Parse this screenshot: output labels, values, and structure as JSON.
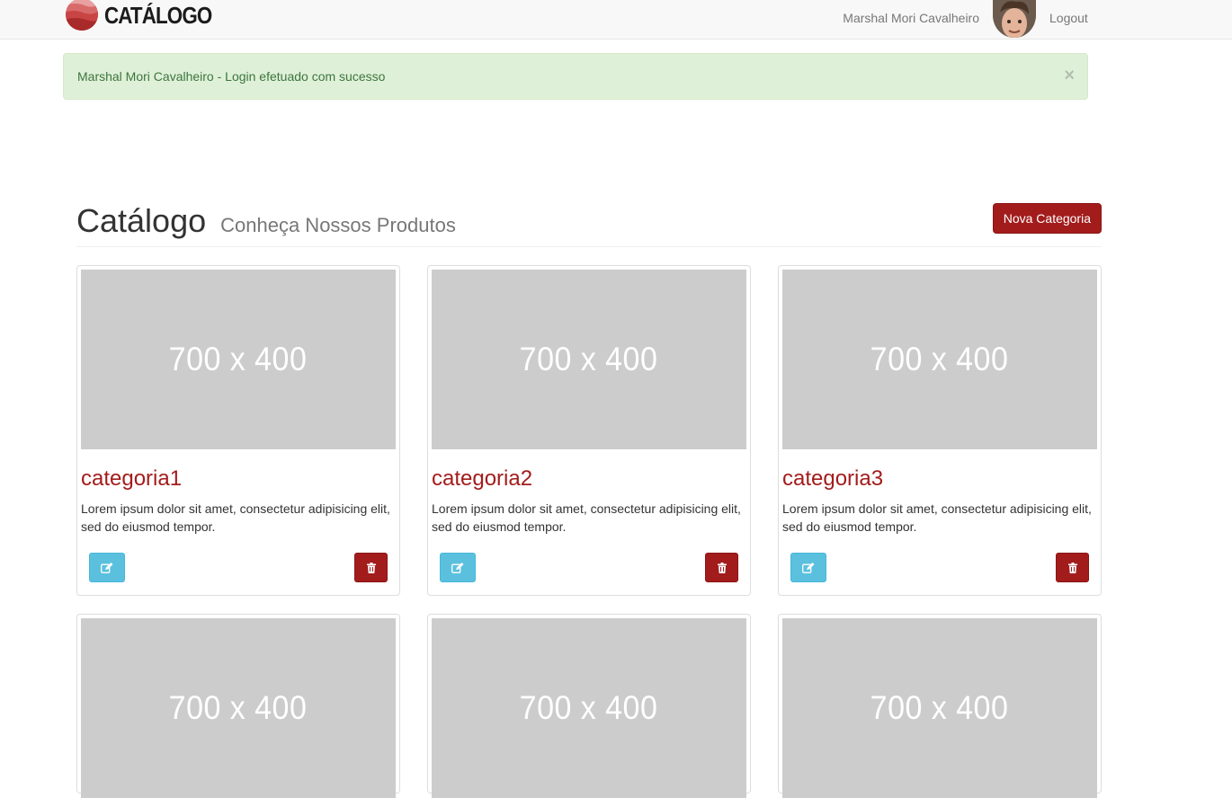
{
  "navbar": {
    "brand_text": "CATÁLOGO",
    "user_name": "Marshal Mori Cavalheiro",
    "logout_label": "Logout"
  },
  "alert": {
    "message": "Marshal Mori Cavalheiro - Login efetuado com sucesso",
    "close_symbol": "×",
    "color": "#dff0d8"
  },
  "page_header": {
    "title": "Catálogo",
    "subtitle": "Conheça Nossos Produtos",
    "new_button_label": "Nova Categoria"
  },
  "cards": [
    {
      "image_label": "700 x 400",
      "title": "categoria1",
      "description": "Lorem ipsum dolor sit amet, consectetur adipisicing elit, sed do eiusmod tempor."
    },
    {
      "image_label": "700 x 400",
      "title": "categoria2",
      "description": "Lorem ipsum dolor sit amet, consectetur adipisicing elit, sed do eiusmod tempor."
    },
    {
      "image_label": "700 x 400",
      "title": "categoria3",
      "description": "Lorem ipsum dolor sit amet, consectetur adipisicing elit, sed do eiusmod tempor."
    },
    {
      "image_label": "700 x 400"
    },
    {
      "image_label": "700 x 400"
    },
    {
      "image_label": "700 x 400"
    }
  ],
  "icons": {
    "edit": "edit-icon",
    "delete": "trash-icon"
  },
  "colors": {
    "brand": "#a31c1c",
    "info": "#5bc0de",
    "placeholder": "#cccccc"
  }
}
